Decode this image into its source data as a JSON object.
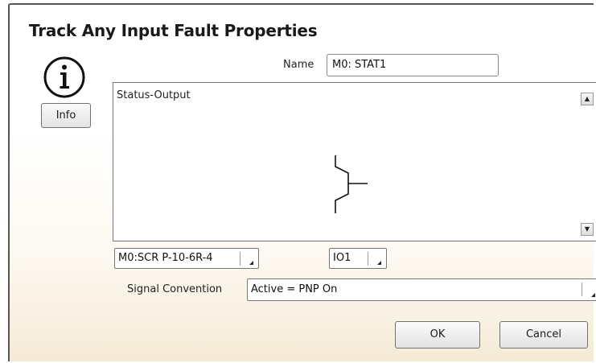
{
  "dialog": {
    "title": "Track Any Input Fault Properties",
    "info_button": "Info",
    "name_label": "Name",
    "name_value": "M0: STAT1",
    "status_text": "Status-Output",
    "module_select": "M0:SCR P-10-6R-4",
    "io_select": "IO1",
    "signal_label": "Signal Convention",
    "signal_select": "Active = PNP On",
    "ok_button": "OK",
    "cancel_button": "Cancel"
  },
  "icons": {
    "info": "info-icon",
    "scroll_up": "scroll-up-arrow-icon",
    "scroll_down": "scroll-down-arrow-icon",
    "dropdown": "dropdown-arrow-icon",
    "contact_symbol": "normally-open-contact-symbol"
  }
}
